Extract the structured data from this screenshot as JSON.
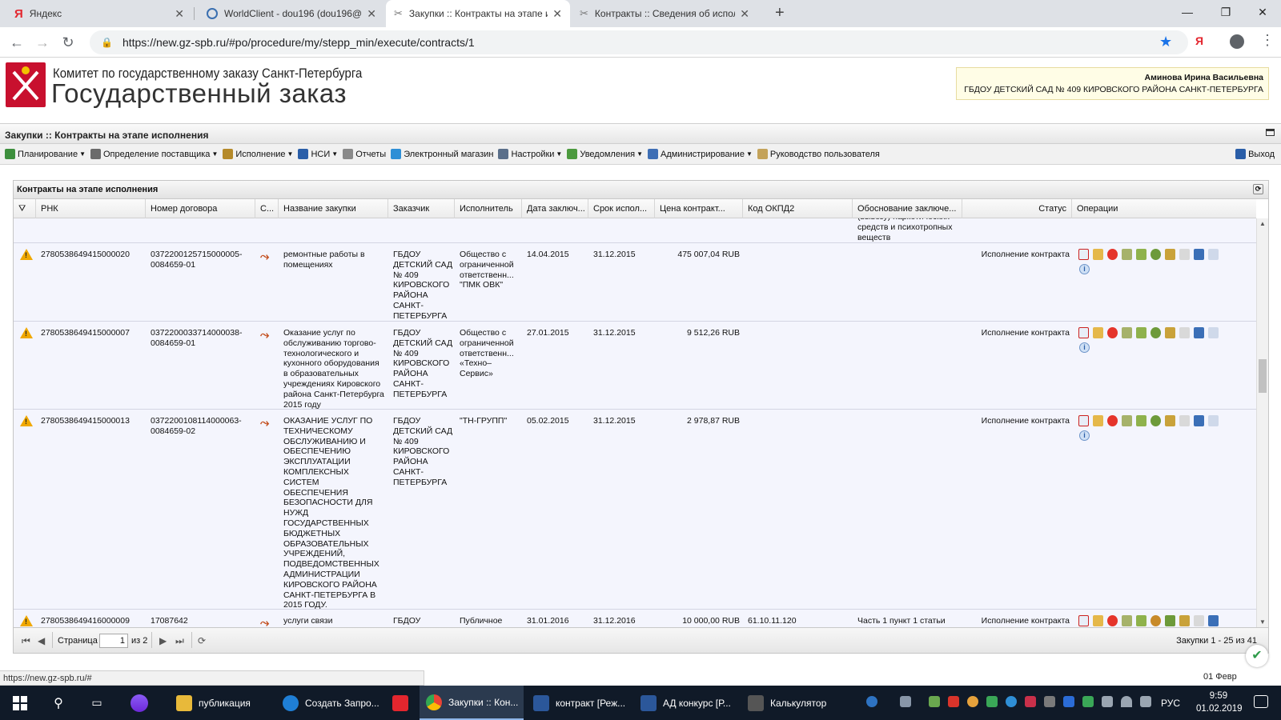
{
  "browser": {
    "tabs": [
      {
        "title": "Яндекс",
        "icon": "yandex-icon"
      },
      {
        "title": "WorldClient - dou196 (dou196@",
        "icon": "globe-icon"
      },
      {
        "title": "Закупки :: Контракты на этапе и",
        "icon": "wrench-icon",
        "active": true
      },
      {
        "title": "Контракты :: Сведения об испол",
        "icon": "wrench-icon"
      }
    ],
    "new_tab": "+",
    "url": "https://new.gz-spb.ru/#po/procedure/my/stepp_min/execute/contracts/1",
    "window_controls": {
      "minimize": "—",
      "maximize": "❐",
      "close": "✕"
    }
  },
  "header": {
    "org_line1": "Комитет по государственному заказу Санкт-Петербурга",
    "org_line2": "Государственный заказ",
    "user_name": "Аминова Ирина Васильевна",
    "user_org": "ГБДОУ ДЕТСКИЙ САД № 409 КИРОВСКОГО РАЙОНА САНКТ-ПЕТЕРБУРГА"
  },
  "page_title": "Закупки :: Контракты на этапе исполнения",
  "menu": [
    {
      "label": "Планирование",
      "dropdown": true,
      "color": "#3d8f3d"
    },
    {
      "label": "Определение поставщика",
      "dropdown": true,
      "color": "#6b6b6b"
    },
    {
      "label": "Исполнение",
      "dropdown": true,
      "color": "#b58a2a"
    },
    {
      "label": "НСИ",
      "dropdown": true,
      "color": "#2a5ea8"
    },
    {
      "label": "Отчеты",
      "dropdown": false,
      "color": "#8a8a8a"
    },
    {
      "label": "Электронный магазин",
      "dropdown": false,
      "color": "#2e8fd6"
    },
    {
      "label": "Настройки",
      "dropdown": true,
      "color": "#5a6f8a"
    },
    {
      "label": "Уведомления",
      "dropdown": true,
      "color": "#4c9a3e"
    },
    {
      "label": "Администрирование",
      "dropdown": true,
      "color": "#3f6fb5"
    },
    {
      "label": "Руководство пользователя",
      "dropdown": false,
      "color": "#c4a35a"
    }
  ],
  "logout_label": "Выход",
  "panel": {
    "title": "Контракты на этапе исполнения",
    "columns": [
      "РНК",
      "Номер договора",
      "С...",
      "Название закупки",
      "Заказчик",
      "Исполнитель",
      "Дата заключ...",
      "Срок испол...",
      "Цена контракт...",
      "Код ОКПД2",
      "Обоснование заключе...",
      "Статус",
      "Операции"
    ],
    "partial_top_text": "(вывозу) наркотических средств и психотропных веществ",
    "rows": [
      {
        "rnk": "2780538649415000020",
        "contract_no": "0372200125715000005-0084659-01",
        "name": "ремонтные работы в помещениях",
        "customer": "ГБДОУ ДЕТСКИЙ САД № 409 КИРОВСКОГО РАЙОНА САНКТ-ПЕТЕРБУРГА",
        "executor": "Общество с ограниченной ответственн... \"ПМК ОВК\"",
        "date": "14.04.2015",
        "term": "31.12.2015",
        "price": "475 007,04 RUB",
        "okpd": "",
        "basis": "",
        "status": "Исполнение контракта"
      },
      {
        "rnk": "2780538649415000007",
        "contract_no": "0372200033714000038-0084659-01",
        "name": "Оказание услуг по обслуживанию торгово-технологического и кухонного оборудования в образовательных учреждениях Кировского района Санкт-Петербурга 2015 году",
        "customer": "ГБДОУ ДЕТСКИЙ САД № 409 КИРОВСКОГО РАЙОНА САНКТ-ПЕТЕРБУРГА",
        "executor": "Общество с ограниченной ответственн... «Техно–Сервис»",
        "date": "27.01.2015",
        "term": "31.12.2015",
        "price": "9 512,26 RUB",
        "okpd": "",
        "basis": "",
        "status": "Исполнение контракта"
      },
      {
        "rnk": "2780538649415000013",
        "contract_no": "0372200108114000063-0084659-02",
        "name": "ОКАЗАНИЕ УСЛУГ ПО ТЕХНИЧЕСКОМУ ОБСЛУЖИВАНИЮ И ОБЕСПЕЧЕНИЮ ЭКСПЛУАТАЦИИ КОМПЛЕКСНЫХ СИСТЕМ ОБЕСПЕЧЕНИЯ БЕЗОПАСНОСТИ ДЛЯ НУЖД ГОСУДАРСТВЕННЫХ БЮДЖЕТНЫХ ОБРАЗОВАТЕЛЬНЫХ УЧРЕЖДЕНИЙ, ПОДВЕДОМСТВЕННЫХ АДМИНИСТРАЦИИ КИРОВСКОГО РАЙОНА САНКТ-ПЕТЕРБУРГА В 2015 ГОДУ.",
        "customer": "ГБДОУ ДЕТСКИЙ САД № 409 КИРОВСКОГО РАЙОНА САНКТ-ПЕТЕРБУРГА",
        "executor": "\"ТН-ГРУПП\"",
        "date": "05.02.2015",
        "term": "31.12.2015",
        "price": "2 978,87 RUB",
        "okpd": "",
        "basis": "",
        "status": "Исполнение контракта"
      },
      {
        "rnk": "2780538649416000009",
        "contract_no": "17087642",
        "name": "услуги связи",
        "customer": "ГБДОУ",
        "executor": "Публичное",
        "date": "31.01.2016",
        "term": "31.12.2016",
        "price": "10 000,00 RUB",
        "okpd": "61.10.11.120",
        "basis": "Часть 1 пункт 1 статьи",
        "status": "Исполнение контракта"
      }
    ],
    "pager": {
      "page_label": "Страница",
      "page_value": "1",
      "of_label": "из 2",
      "summary": "Закупки 1 - 25 из 41"
    }
  },
  "statusbar_url": "https://new.gz-spb.ru/#",
  "date_footer": "01 Февр",
  "taskbar": {
    "items": [
      {
        "label": "публикация",
        "color": "#e8b93a"
      },
      {
        "label": "Создать Запро...",
        "color": "#1f7fd6"
      },
      {
        "label": "",
        "color": "#e3262e"
      },
      {
        "label": "Закупки :: Кон...",
        "color": "#4285f4",
        "active": true
      },
      {
        "label": "контракт [Реж...",
        "color": "#2b579a"
      },
      {
        "label": "АД конкурс [Р...",
        "color": "#2b579a"
      },
      {
        "label": "Калькулятор",
        "color": "#555555"
      }
    ],
    "lang": "РУС",
    "time": "9:59",
    "date": "01.02.2019"
  }
}
